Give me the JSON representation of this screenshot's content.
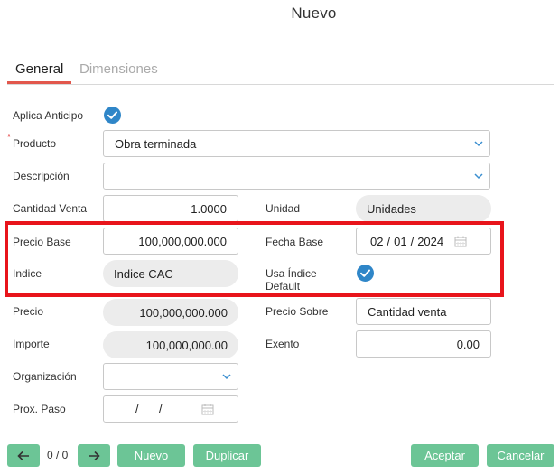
{
  "window": {
    "title": "Nuevo"
  },
  "tabs": [
    {
      "label": "General",
      "active": true
    },
    {
      "label": "Dimensiones",
      "active": false
    }
  ],
  "form": {
    "aplica_anticipo": {
      "label": "Aplica Anticipo",
      "checked": true
    },
    "producto": {
      "label": "Producto",
      "required_marker": "*",
      "value": "Obra terminada"
    },
    "descripcion": {
      "label": "Descripción",
      "value": ""
    },
    "cantidad_venta": {
      "label": "Cantidad Venta",
      "value": "1.0000"
    },
    "unidad": {
      "label": "Unidad",
      "value": "Unidades"
    },
    "precio_base": {
      "label": "Precio Base",
      "value": "100,000,000.000"
    },
    "fecha_base": {
      "label": "Fecha Base",
      "month": "02",
      "day": "01",
      "year": "2024",
      "sep": "/"
    },
    "indice": {
      "label": "Indice",
      "value": "Indice CAC"
    },
    "usa_indice_default": {
      "label_line1": "Usa Índice",
      "label_line2": "Default",
      "checked": true
    },
    "precio": {
      "label": "Precio",
      "value": "100,000,000.000"
    },
    "precio_sobre": {
      "label": "Precio Sobre",
      "value": "Cantidad venta"
    },
    "importe": {
      "label": "Importe",
      "value": "100,000,000.00"
    },
    "exento": {
      "label": "Exento",
      "value": "0.00"
    },
    "organizacion": {
      "label": "Organización",
      "value": ""
    },
    "prox_paso": {
      "label": "Prox. Paso",
      "sep": "/"
    }
  },
  "footer": {
    "record_count": "0 / 0",
    "nuevo_label": "Nuevo",
    "duplicar_label": "Duplicar",
    "aceptar_label": "Aceptar",
    "cancelar_label": "Cancelar"
  },
  "colors": {
    "accent_tab": "#e2574c",
    "highlight": "#e8141b",
    "check": "#2f86c8",
    "button": "#6cc596"
  }
}
